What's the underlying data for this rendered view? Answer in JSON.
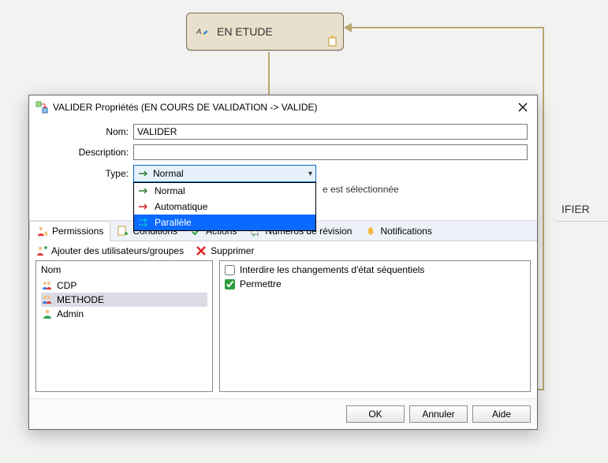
{
  "diagram": {
    "node_etude": "EN ETUDE",
    "node_ifier": "IFIER"
  },
  "dialog": {
    "title": "VALIDER Propriétés (EN COURS DE VALIDATION -> VALIDE)",
    "labels": {
      "nom": "Nom:",
      "description": "Description:",
      "type": "Type:"
    },
    "values": {
      "nom": "VALIDER",
      "description": ""
    },
    "type": {
      "selected": "Normal",
      "options": [
        "Normal",
        "Automatique",
        "Parallèle"
      ],
      "hover_index": 2
    },
    "auth_text": "e est sélectionnée",
    "tabs": [
      "Permissions",
      "Conditions",
      "Actions",
      "Numéros de révision",
      "Notifications"
    ],
    "toolbar": {
      "add": "Ajouter des utilisateurs/groupes",
      "delete": "Supprimer"
    },
    "left_panel": {
      "header": "Nom",
      "rows": [
        {
          "name": "CDP",
          "kind": "group"
        },
        {
          "name": "METHODE",
          "kind": "group",
          "selected": true
        },
        {
          "name": "Admin",
          "kind": "user"
        }
      ]
    },
    "right_panel": {
      "cb1": {
        "label": "Interdire les changements d'état séquentiels",
        "checked": false
      },
      "cb2": {
        "label": "Permettre",
        "checked": true
      }
    },
    "buttons": {
      "ok": "OK",
      "cancel": "Annuler",
      "help": "Aide"
    }
  }
}
